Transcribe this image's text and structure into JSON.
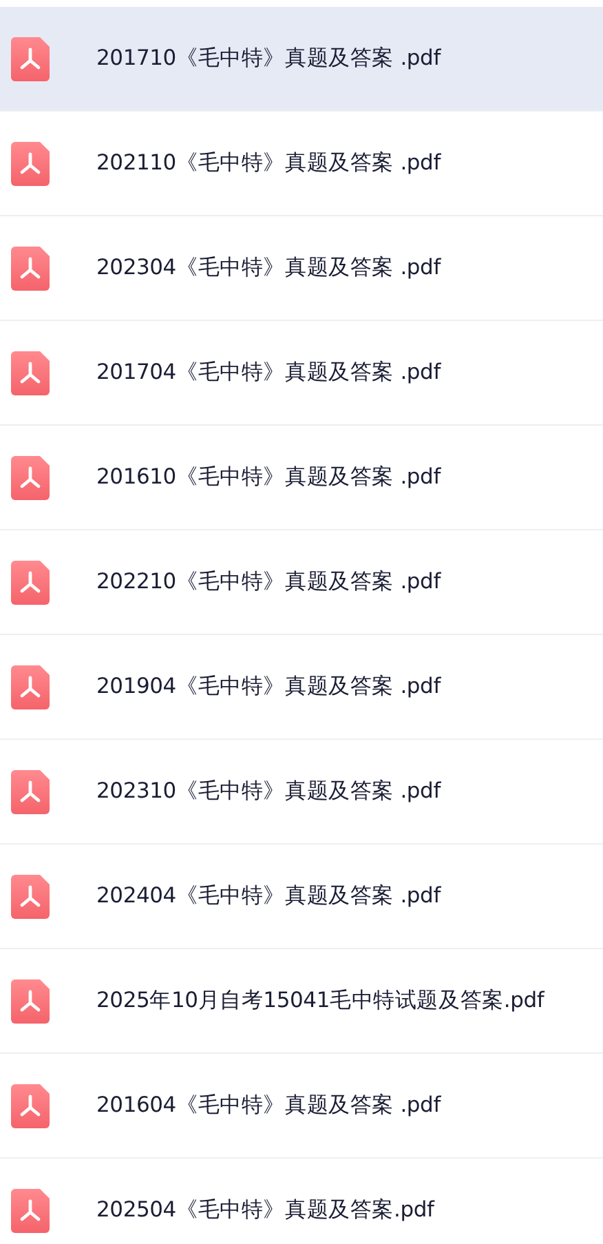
{
  "files": [
    {
      "name": "201710《毛中特》真题及答案 .pdf",
      "selected": true
    },
    {
      "name": "202110《毛中特》真题及答案 .pdf",
      "selected": false
    },
    {
      "name": "202304《毛中特》真题及答案 .pdf",
      "selected": false
    },
    {
      "name": "201704《毛中特》真题及答案 .pdf",
      "selected": false
    },
    {
      "name": "201610《毛中特》真题及答案 .pdf",
      "selected": false
    },
    {
      "name": "202210《毛中特》真题及答案 .pdf",
      "selected": false
    },
    {
      "name": "201904《毛中特》真题及答案 .pdf",
      "selected": false
    },
    {
      "name": "202310《毛中特》真题及答案 .pdf",
      "selected": false
    },
    {
      "name": "202404《毛中特》真题及答案 .pdf",
      "selected": false
    },
    {
      "name": "2025年10月自考15041毛中特试题及答案.pdf",
      "selected": false
    },
    {
      "name": "201604《毛中特》真题及答案 .pdf",
      "selected": false
    },
    {
      "name": "202504《毛中特》真题及答案.pdf",
      "selected": false
    }
  ]
}
